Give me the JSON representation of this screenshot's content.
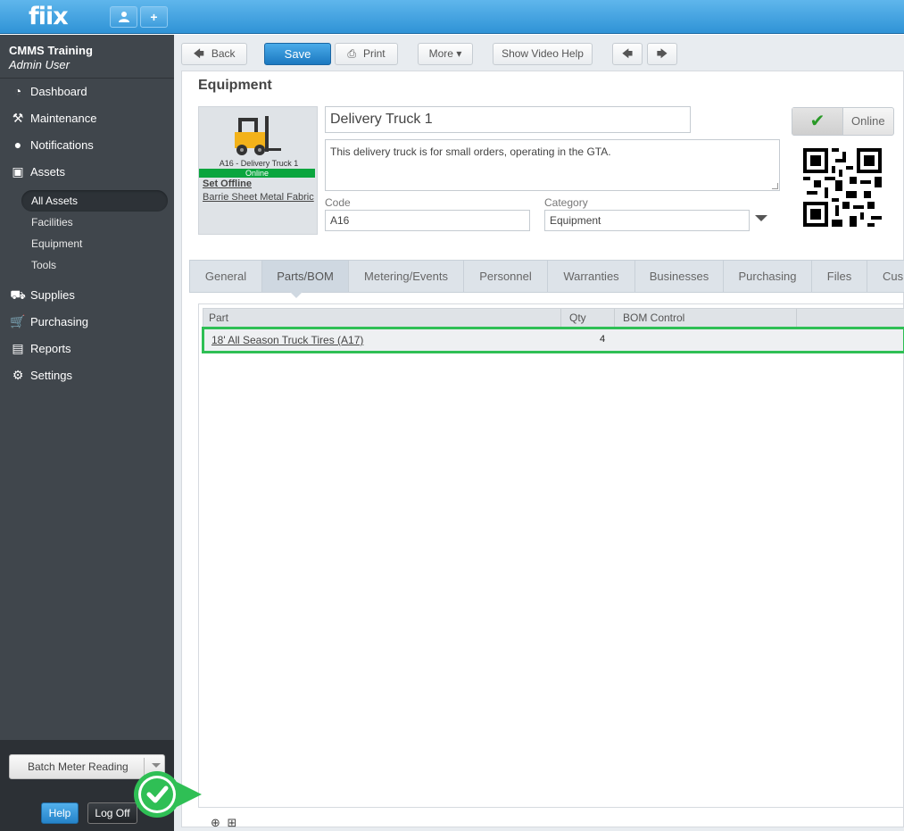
{
  "topbar": {
    "logo": "fiix",
    "user_btn_icon": "user-icon",
    "add_btn_label": "+"
  },
  "sidebar": {
    "company": "CMMS Training",
    "user": "Admin User",
    "nav": [
      {
        "label": "Dashboard",
        "icon": "dashboard-icon"
      },
      {
        "label": "Maintenance",
        "icon": "wrench-icon"
      },
      {
        "label": "Notifications",
        "icon": "speech-bubble-icon"
      },
      {
        "label": "Assets",
        "icon": "box-icon"
      }
    ],
    "asset_sub": [
      {
        "label": "All Assets",
        "active": true
      },
      {
        "label": "Facilities"
      },
      {
        "label": "Equipment"
      },
      {
        "label": "Tools"
      }
    ],
    "nav2": [
      {
        "label": "Supplies",
        "icon": "truck-icon"
      },
      {
        "label": "Purchasing",
        "icon": "cart-icon"
      },
      {
        "label": "Reports",
        "icon": "chart-icon"
      },
      {
        "label": "Settings",
        "icon": "gear-icon"
      }
    ],
    "batch_label": "Batch Meter Reading",
    "help_label": "Help",
    "logoff_label": "Log Off"
  },
  "toolbar": {
    "back_label": "Back",
    "save_label": "Save",
    "print_label": "Print",
    "more_label": "More",
    "video_label": "Show Video Help"
  },
  "equipment": {
    "section_title": "Equipment",
    "caption": "A16 - Delivery Truck 1",
    "status_bar": "Online",
    "set_offline": "Set Offline",
    "location": "Barrie Sheet Metal Fabric",
    "name": "Delivery Truck 1",
    "description": "This delivery truck is for small orders, operating in the GTA.",
    "code_label": "Code",
    "code": "A16",
    "category_label": "Category",
    "category": "Equipment",
    "online_label": "Online"
  },
  "tabs": [
    "General",
    "Parts/BOM",
    "Metering/Events",
    "Personnel",
    "Warranties",
    "Businesses",
    "Purchasing",
    "Files",
    "Cus"
  ],
  "active_tab": "Parts/BOM",
  "grid": {
    "columns": [
      "Part",
      "Qty",
      "BOM Control"
    ],
    "rows": [
      {
        "part": "18' All Season Truck Tires (A17)",
        "qty": "4"
      }
    ]
  },
  "colors": {
    "accent": "#2f93d6",
    "highlight": "#2fbf55",
    "status_green": "#0aa53e"
  }
}
